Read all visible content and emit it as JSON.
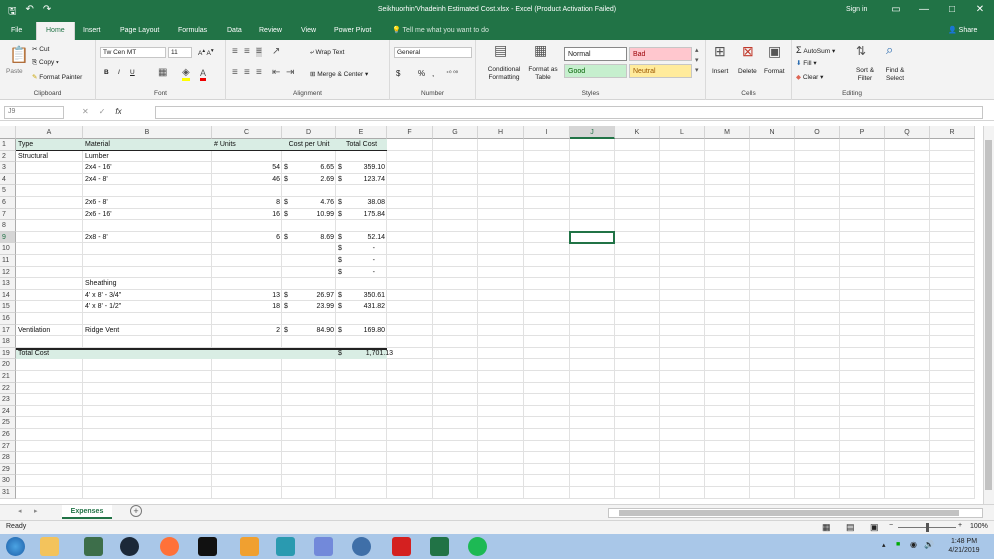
{
  "window": {
    "title": "Seikhuorhin'Vhadeinh Estimated Cost.xlsx  -  Excel (Product Activation Failed)",
    "signin": "Sign in",
    "minimize": "—",
    "maximize": "□",
    "close": "✕"
  },
  "tabs": [
    "File",
    "Home",
    "Insert",
    "Page Layout",
    "Formulas",
    "Data",
    "Review",
    "View",
    "Power Pivot"
  ],
  "tellme": "Tell me what you want to do",
  "share": "Share",
  "ribbon": {
    "clipboard": {
      "label": "Clipboard",
      "paste": "Paste",
      "cut": "Cut",
      "copy": "Copy",
      "format_painter": "Format Painter"
    },
    "font": {
      "label": "Font",
      "name": "Tw Cen MT",
      "size": "11",
      "bold": "B",
      "italic": "I",
      "underline": "U"
    },
    "alignment": {
      "label": "Alignment",
      "wrap": "Wrap Text",
      "merge": "Merge & Center"
    },
    "number": {
      "label": "Number",
      "format": "General",
      "currency": "$",
      "percent": "%",
      "comma": ","
    },
    "styles": {
      "label": "Styles",
      "conditional": "Conditional Formatting",
      "format_table": "Format as Table",
      "normal": "Normal",
      "bad": "Bad",
      "good": "Good",
      "neutral": "Neutral"
    },
    "cells": {
      "label": "Cells",
      "insert": "Insert",
      "delete": "Delete",
      "format": "Format"
    },
    "editing": {
      "label": "Editing",
      "autosum": "AutoSum",
      "fill": "Fill",
      "clear": "Clear",
      "sort": "Sort & Filter",
      "find": "Find & Select"
    }
  },
  "formula_bar": {
    "namebox": "J9",
    "fx": "fx",
    "content": ""
  },
  "columns": [
    "A",
    "B",
    "C",
    "D",
    "E",
    "F",
    "G",
    "H",
    "I",
    "J",
    "K",
    "L",
    "M",
    "N",
    "O",
    "P",
    "Q",
    "R"
  ],
  "selected": {
    "col": "J",
    "row": 9
  },
  "header_row": {
    "A": "Type",
    "B": "Material",
    "C": "# Units",
    "D": "Cost per Unit",
    "E": "Total Cost"
  },
  "rows": [
    {
      "r": 2,
      "A": "Structural",
      "B": "Lumber"
    },
    {
      "r": 3,
      "B": "2x4 - 16'",
      "C": "54",
      "D": "6.65",
      "E": "359.10"
    },
    {
      "r": 4,
      "B": "2x4 - 8'",
      "C": "46",
      "D": "2.69",
      "E": "123.74"
    },
    {
      "r": 6,
      "B": "2x6 - 8'",
      "C": "8",
      "D": "4.76",
      "E": "38.08"
    },
    {
      "r": 7,
      "B": "2x6 - 16'",
      "C": "16",
      "D": "10.99",
      "E": "175.84"
    },
    {
      "r": 9,
      "B": "2x8 - 8'",
      "C": "6",
      "D": "8.69",
      "E": "52.14"
    },
    {
      "r": 10,
      "E": "-"
    },
    {
      "r": 11,
      "E": "-"
    },
    {
      "r": 12,
      "E": "-"
    },
    {
      "r": 13,
      "B": "Sheathing"
    },
    {
      "r": 14,
      "B": "4' x 8' - 3/4\"",
      "C": "13",
      "D": "26.97",
      "E": "350.61"
    },
    {
      "r": 15,
      "B": "4' x 8' - 1/2\"",
      "C": "18",
      "D": "23.99",
      "E": "431.82"
    },
    {
      "r": 17,
      "A": "Ventilation",
      "B": "Ridge Vent",
      "C": "2",
      "D": "84.90",
      "E": "169.80"
    }
  ],
  "total_row": {
    "r": 19,
    "A": "Total Cost",
    "E": "1,701.13"
  },
  "currency_symbol": "$",
  "sheet": {
    "name": "Expenses",
    "add": "+"
  },
  "status": {
    "left": "Ready",
    "zoom": "100%"
  },
  "clock": {
    "time": "1:48 PM",
    "date": "4/21/2019"
  },
  "colors": {
    "excel_green": "#217346",
    "header_fill": "#d9ede4",
    "bad_fill": "#ffc7ce",
    "good_fill": "#c6efce",
    "neutral_fill": "#ffeb9c"
  }
}
